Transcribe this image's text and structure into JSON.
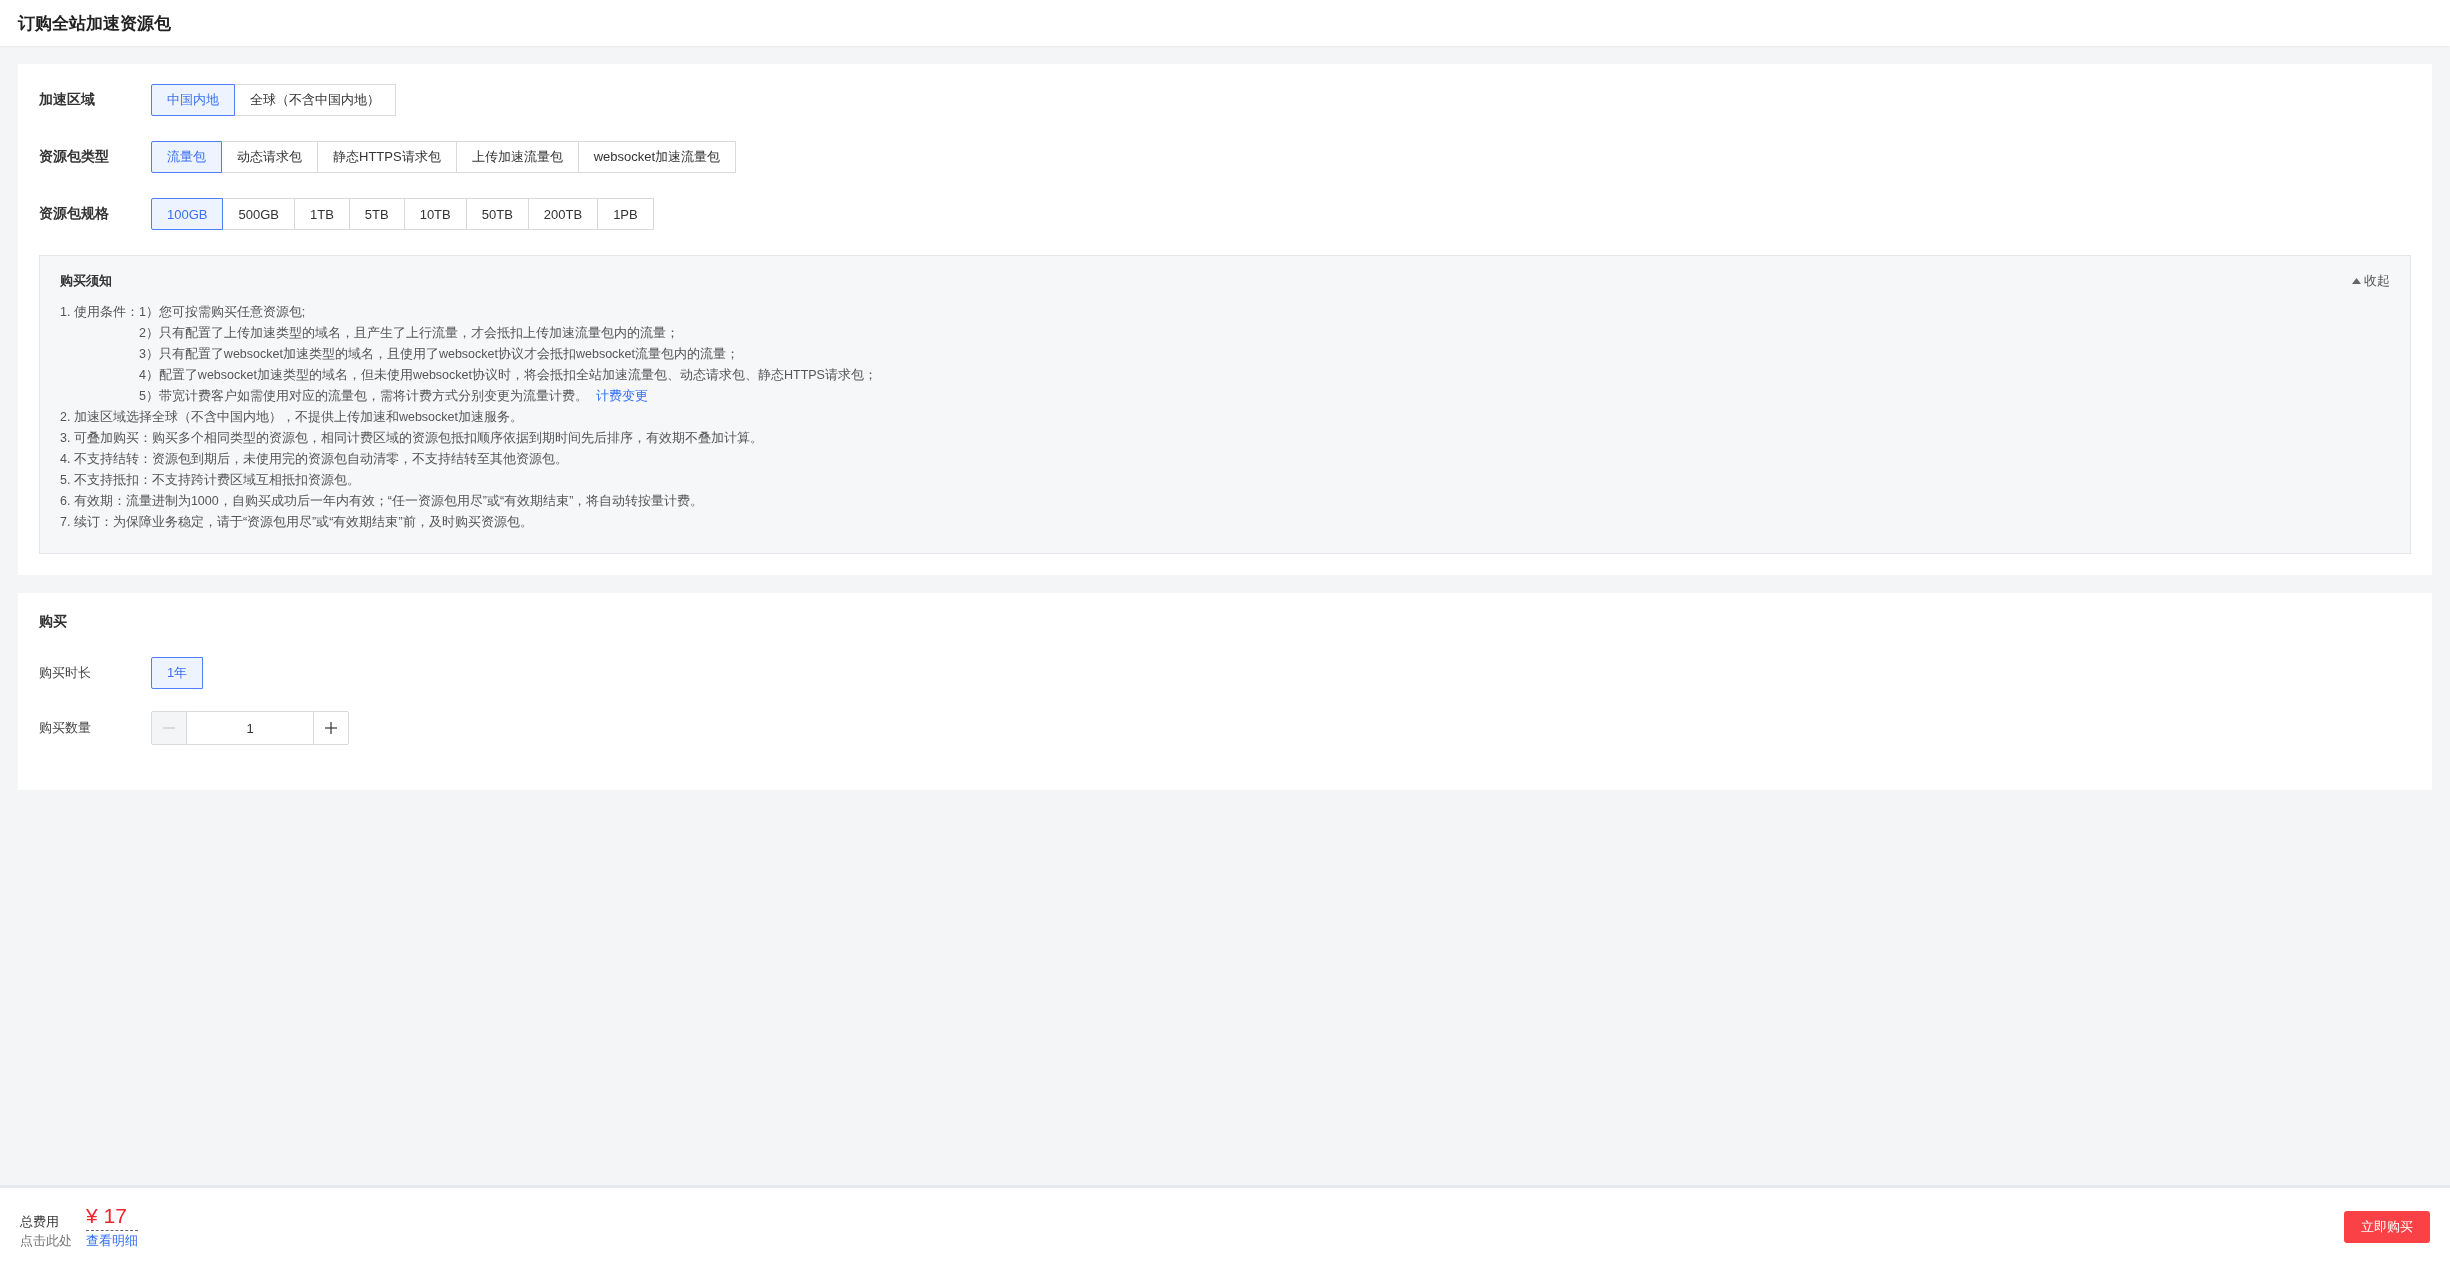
{
  "header": {
    "title": "订购全站加速资源包"
  },
  "options": [
    {
      "label": "加速区域",
      "choices": [
        {
          "label": "中国内地",
          "selected": true
        },
        {
          "label": "全球（不含中国内地）",
          "selected": false
        }
      ]
    },
    {
      "label": "资源包类型",
      "choices": [
        {
          "label": "流量包",
          "selected": true
        },
        {
          "label": "动态请求包",
          "selected": false
        },
        {
          "label": "静态HTTPS请求包",
          "selected": false
        },
        {
          "label": "上传加速流量包",
          "selected": false
        },
        {
          "label": "websocket加速流量包",
          "selected": false
        }
      ]
    },
    {
      "label": "资源包规格",
      "choices": [
        {
          "label": "100GB",
          "selected": true
        },
        {
          "label": "500GB",
          "selected": false
        },
        {
          "label": "1TB",
          "selected": false
        },
        {
          "label": "5TB",
          "selected": false
        },
        {
          "label": "10TB",
          "selected": false
        },
        {
          "label": "50TB",
          "selected": false
        },
        {
          "label": "200TB",
          "selected": false
        },
        {
          "label": "1PB",
          "selected": false
        }
      ]
    }
  ],
  "notice": {
    "title": "购买须知",
    "toggle": "收起",
    "expanded": true,
    "items": [
      {
        "text": "1. 使用条件：",
        "children": [
          {
            "text": "1）您可按需购买任意资源包;"
          },
          {
            "text": "2）只有配置了上传加速类型的域名，且产生了上行流量，才会抵扣上传加速流量包内的流量；"
          },
          {
            "text": "3）只有配置了websocket加速类型的域名，且使用了websocket协议才会抵扣websocket流量包内的流量；"
          },
          {
            "text": "4）配置了websocket加速类型的域名，但未使用websocket协议时，将会抵扣全站加速流量包、动态请求包、静态HTTPS请求包；"
          },
          {
            "text": "5）带宽计费客户如需使用对应的流量包，需将计费方式分别变更为流量计费。",
            "link": "计费变更"
          }
        ]
      },
      {
        "text": "2. 加速区域选择全球（不含中国内地），不提供上传加速和websocket加速服务。"
      },
      {
        "text": "3. 可叠加购买：购买多个相同类型的资源包，相同计费区域的资源包抵扣顺序依据到期时间先后排序，有效期不叠加计算。"
      },
      {
        "text": "4. 不支持结转：资源包到期后，未使用完的资源包自动清零，不支持结转至其他资源包。"
      },
      {
        "text": "5. 不支持抵扣：不支持跨计费区域互相抵扣资源包。"
      },
      {
        "text": "6. 有效期：流量进制为1000，自购买成功后一年内有效；“任一资源包用尽”或“有效期结束”，将自动转按量计费。"
      },
      {
        "text": "7. 续订：为保障业务稳定，请于“资源包用尽”或“有效期结束”前，及时购买资源包。"
      }
    ]
  },
  "purchase": {
    "title": "购买",
    "duration": {
      "label": "购买时长",
      "choices": [
        {
          "label": "1年",
          "selected": true
        }
      ]
    },
    "quantity": {
      "label": "购买数量",
      "value": "1",
      "minus_disabled": true,
      "plus_disabled": false
    }
  },
  "footer": {
    "total_label": "总费用",
    "price": "¥ 17",
    "hint": "点击此处",
    "detail_link": "查看明细",
    "buy_button": "立即购买"
  }
}
